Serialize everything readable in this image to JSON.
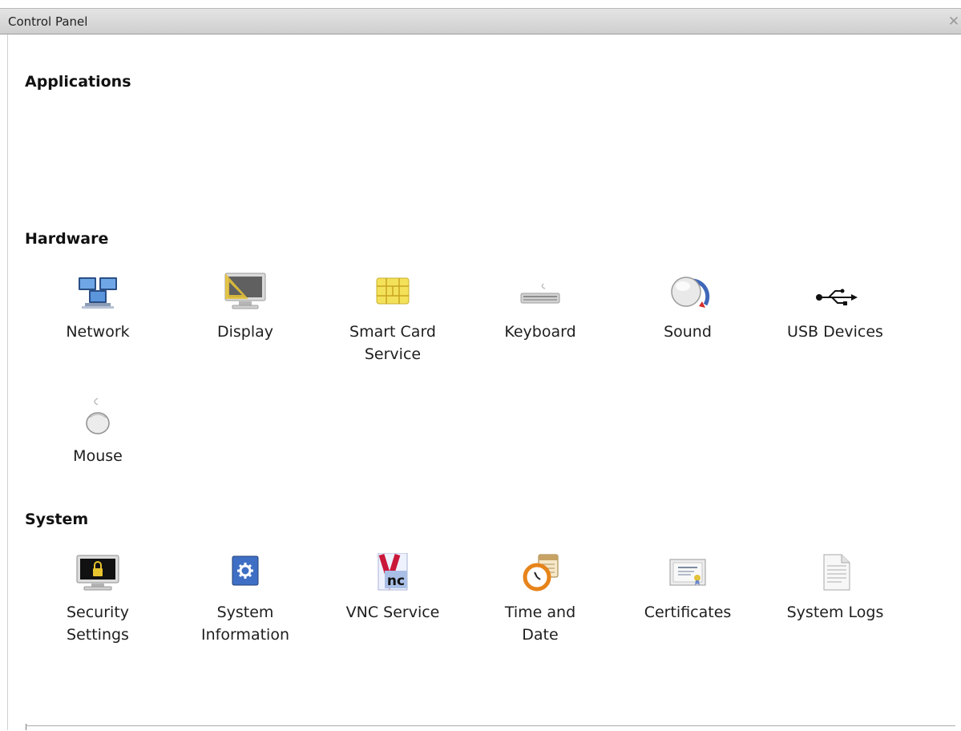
{
  "window": {
    "title": "Control Panel",
    "close_glyph": "✕"
  },
  "sections": {
    "applications": {
      "title": "Applications"
    },
    "hardware": {
      "title": "Hardware",
      "items": [
        {
          "label": "Network",
          "icon": "network-icon"
        },
        {
          "label": "Display",
          "icon": "display-icon"
        },
        {
          "label": "Smart Card\nService",
          "icon": "smart-card-icon"
        },
        {
          "label": "Keyboard",
          "icon": "keyboard-icon"
        },
        {
          "label": "Sound",
          "icon": "sound-icon"
        },
        {
          "label": "USB Devices",
          "icon": "usb-icon"
        },
        {
          "label": "Mouse",
          "icon": "mouse-icon"
        }
      ]
    },
    "system": {
      "title": "System",
      "items": [
        {
          "label": "Security\nSettings",
          "icon": "security-icon"
        },
        {
          "label": "System\nInformation",
          "icon": "system-info-icon"
        },
        {
          "label": "VNC Service",
          "icon": "vnc-icon"
        },
        {
          "label": "Time and\nDate",
          "icon": "clock-calendar-icon"
        },
        {
          "label": "Certificates",
          "icon": "certificate-icon"
        },
        {
          "label": "System Logs",
          "icon": "log-document-icon"
        }
      ]
    }
  },
  "icon_text": {
    "vnc": "nc"
  }
}
